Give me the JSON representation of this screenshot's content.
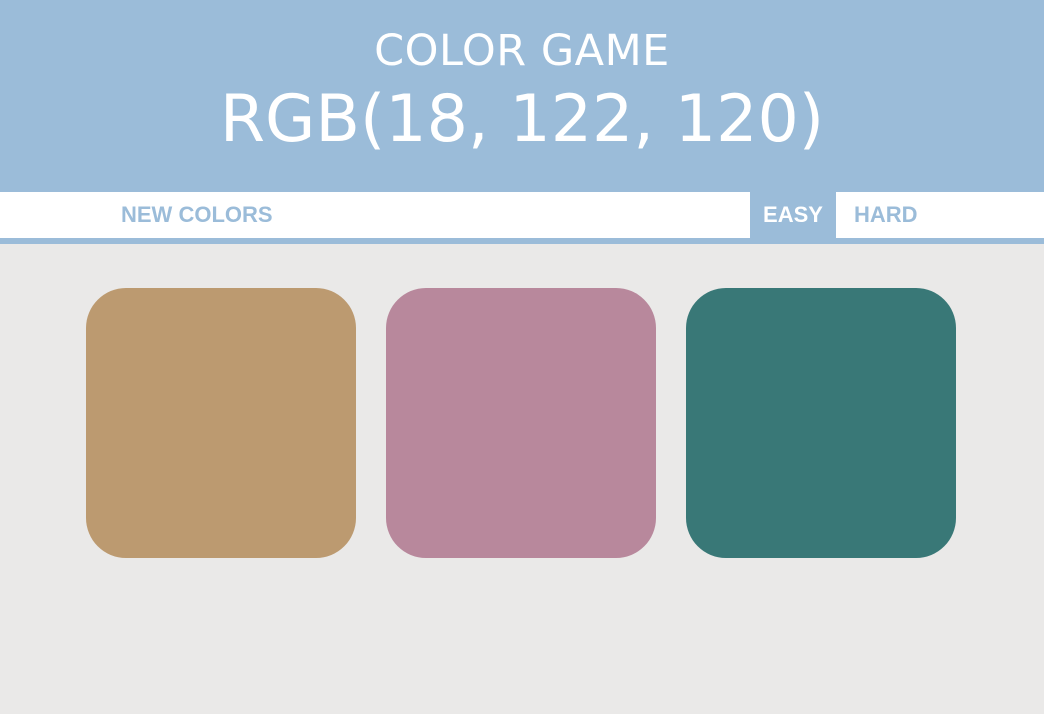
{
  "header": {
    "title": "COLOR GAME",
    "target_rgb": "RGB(18, 122, 120)"
  },
  "controls": {
    "new_colors_label": "NEW COLORS",
    "easy_label": "EASY",
    "hard_label": "HARD",
    "selected_mode": "EASY"
  },
  "colors": {
    "accent": "#9bbcd9",
    "background": "#eae9e8"
  },
  "squares": [
    {
      "color": "#bc9a70"
    },
    {
      "color": "#b8889c"
    },
    {
      "color": "#397877"
    }
  ]
}
